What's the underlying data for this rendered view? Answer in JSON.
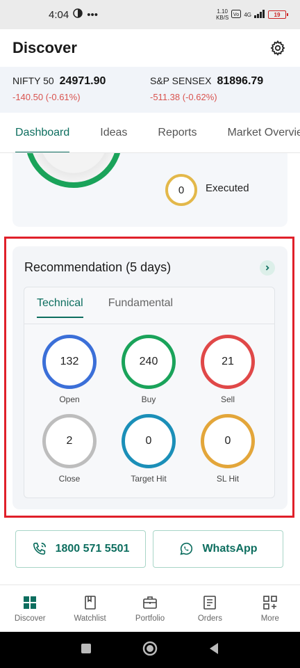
{
  "status_bar": {
    "time": "4:04",
    "dots": "•••",
    "data_speed": "1.10",
    "data_unit": "KB/S",
    "network": "4G",
    "battery": "19"
  },
  "header": {
    "title": "Discover",
    "settings_icon": "gear-icon"
  },
  "indices": [
    {
      "name": "NIFTY 50",
      "value": "24971.90",
      "change": "-140.50  (-0.61%)"
    },
    {
      "name": "S&P SENSEX",
      "value": "81896.79",
      "change": "-511.38  (-0.62%)"
    }
  ],
  "tabs": [
    {
      "label": "Dashboard",
      "active": true
    },
    {
      "label": "Ideas",
      "active": false
    },
    {
      "label": "Reports",
      "active": false
    },
    {
      "label": "Market Overview",
      "active": false
    }
  ],
  "summary": {
    "executed_count": "0",
    "executed_label": "Executed",
    "ring_color": "#1aa35a",
    "executed_color": "#e3b84a"
  },
  "recommendation": {
    "title": "Recommendation (5 days)",
    "tabs": [
      {
        "label": "Technical",
        "active": true
      },
      {
        "label": "Fundamental",
        "active": false
      }
    ],
    "stats": [
      {
        "label": "Open",
        "value": "132",
        "color": "#3b6fd8"
      },
      {
        "label": "Buy",
        "value": "240",
        "color": "#1aa35a"
      },
      {
        "label": "Sell",
        "value": "21",
        "color": "#e04848"
      },
      {
        "label": "Close",
        "value": "2",
        "color": "#bdbdbd"
      },
      {
        "label": "Target Hit",
        "value": "0",
        "color": "#1b8fb8"
      },
      {
        "label": "SL Hit",
        "value": "0",
        "color": "#e3a63a"
      }
    ]
  },
  "contact": {
    "phone_label": "1800 571 5501",
    "whatsapp_label": "WhatsApp"
  },
  "bottom_nav": [
    {
      "label": "Discover",
      "icon": "discover-grid-icon",
      "active": true
    },
    {
      "label": "Watchlist",
      "icon": "book-icon",
      "active": false
    },
    {
      "label": "Portfolio",
      "icon": "briefcase-icon",
      "active": false
    },
    {
      "label": "Orders",
      "icon": "orders-list-icon",
      "active": false
    },
    {
      "label": "More",
      "icon": "more-grid-icon",
      "active": false
    }
  ],
  "colors": {
    "accent": "#0d6e5f",
    "negative": "#d9534f",
    "highlight_outline": "#e0202a"
  }
}
